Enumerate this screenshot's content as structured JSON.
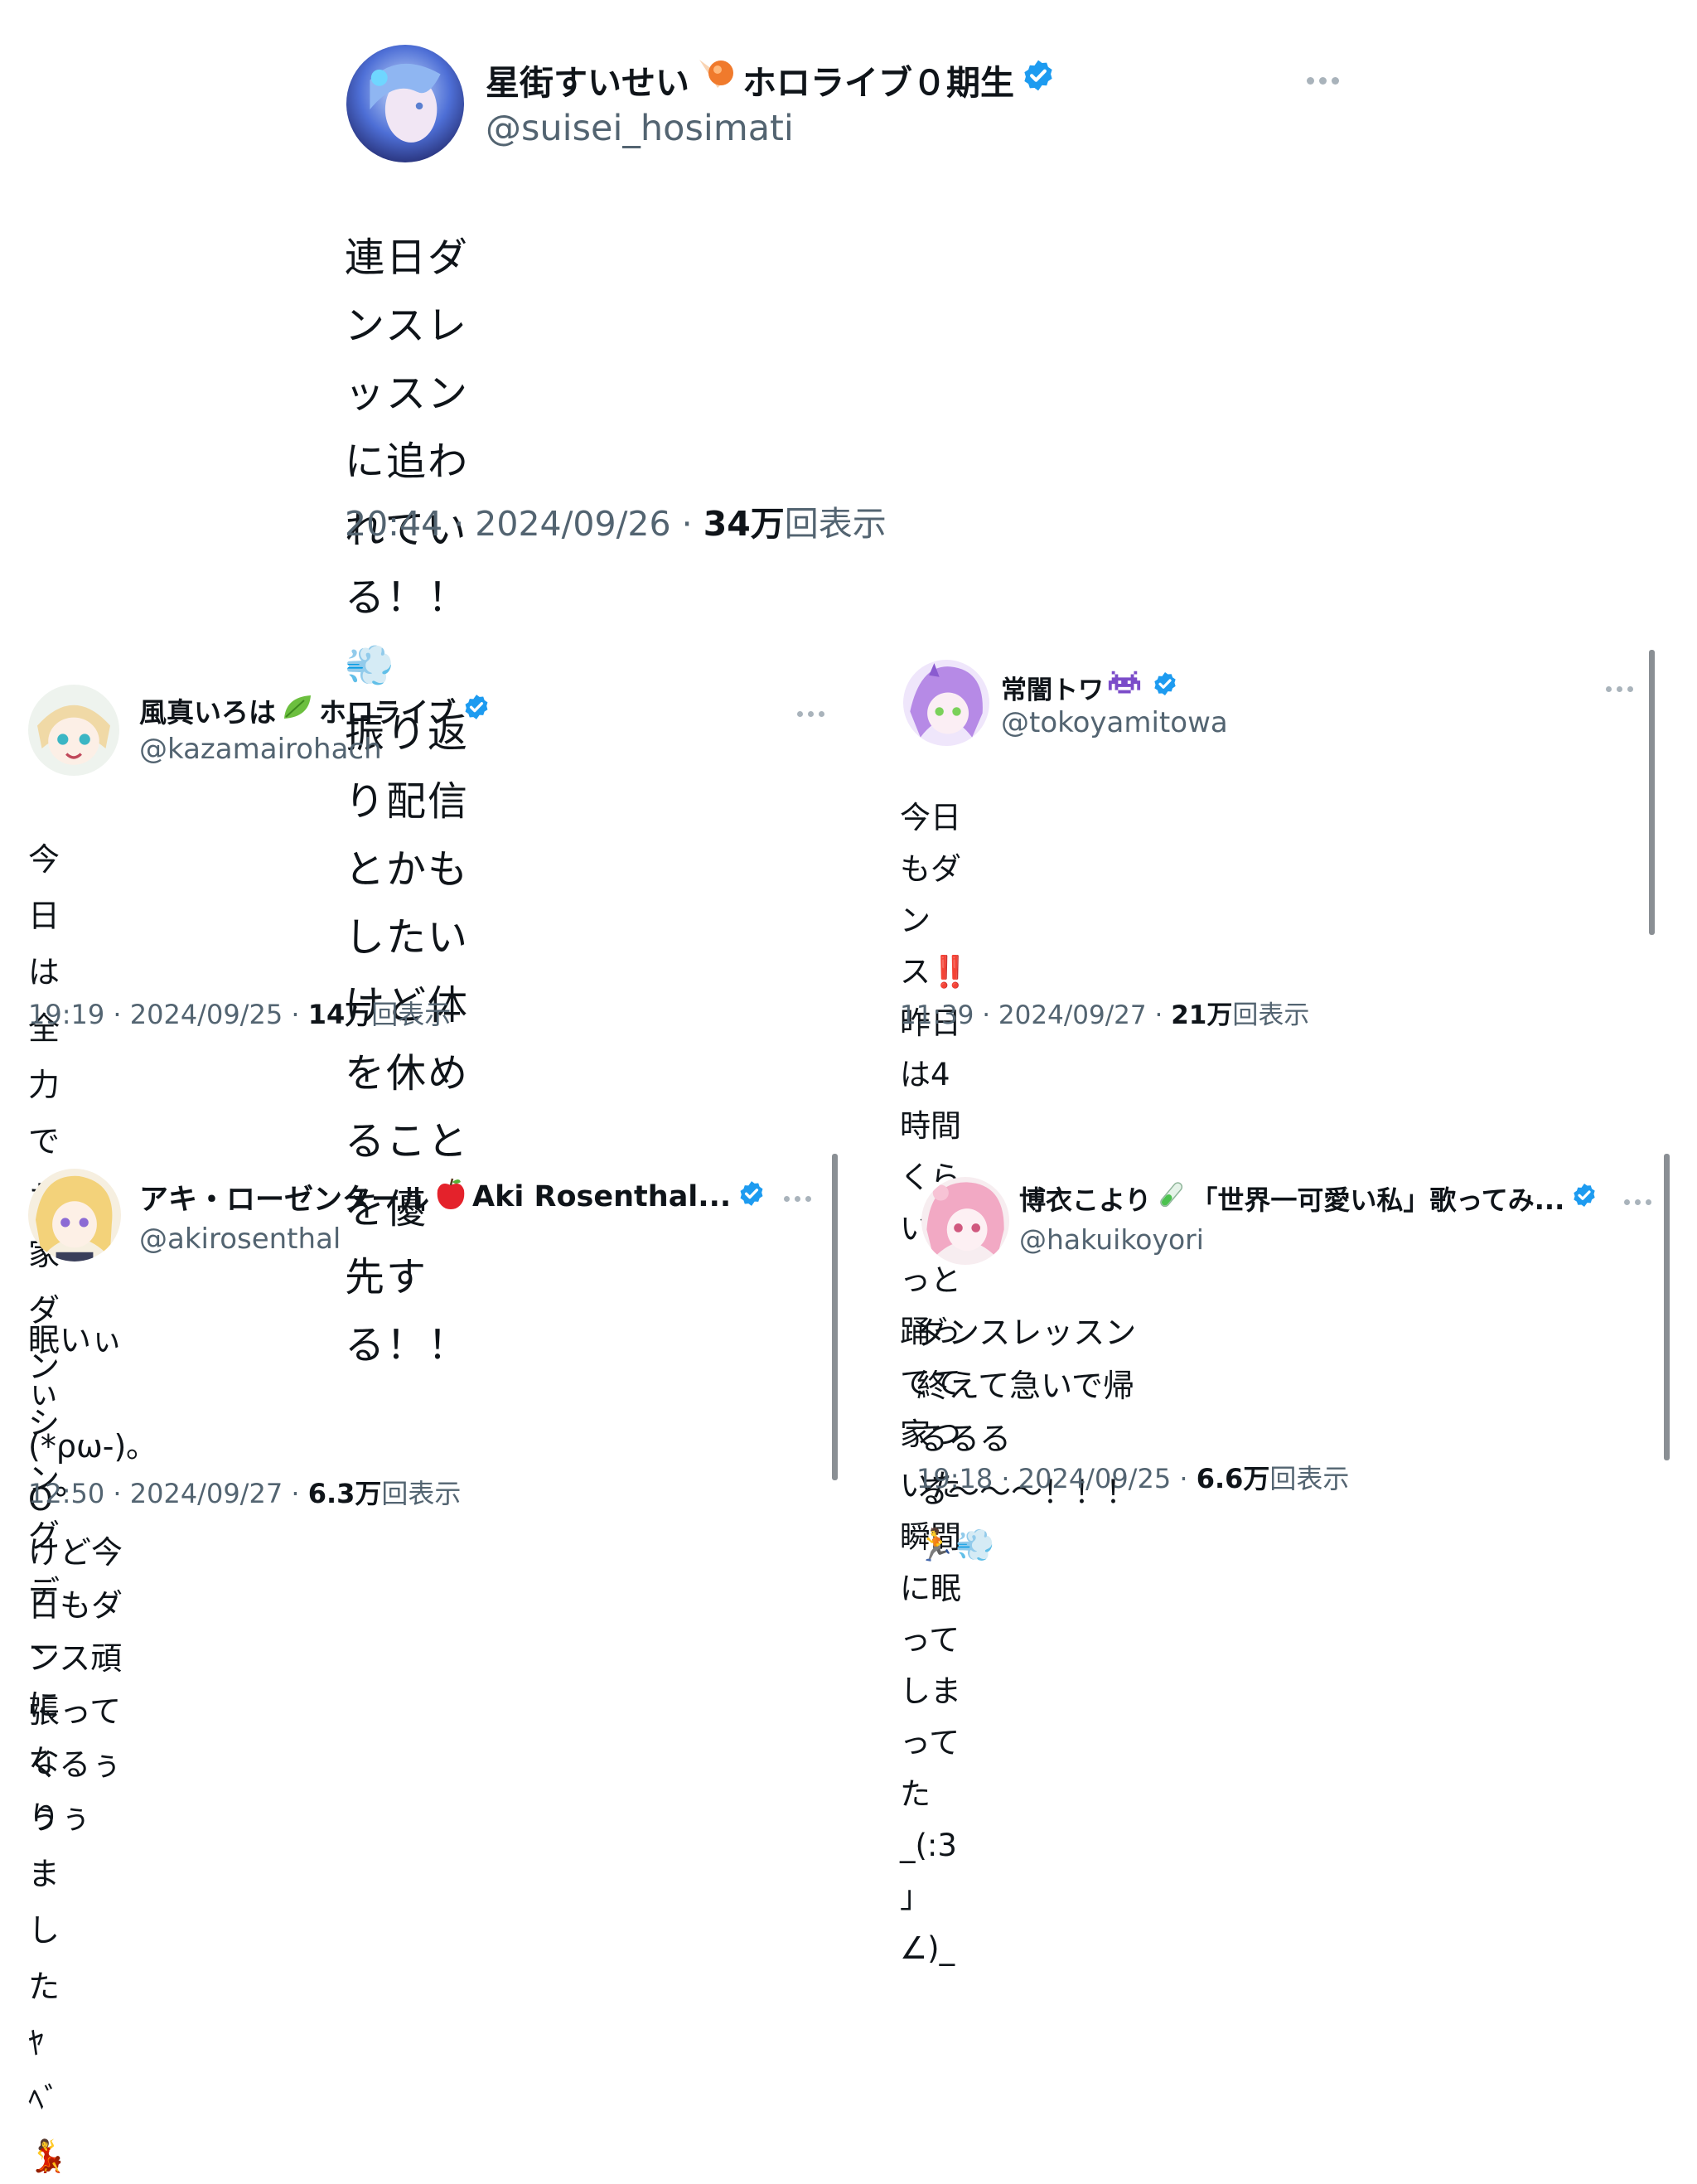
{
  "tweets": {
    "suisei": {
      "name": "星街すいせい",
      "name_suffix": "ホロライブ０期生",
      "name_emoji": "comet-emoji",
      "handle": "@suisei_hosimati",
      "body": "連日ダンスレッスンに追われている！！💨\n振り返り配信とかもしたいけど体を休めることを優\n先する！！",
      "time": "20:44",
      "date": "2024/09/26",
      "views": "34万",
      "views_label": "回表示"
    },
    "iroha": {
      "name": "風真いろは",
      "name_suffix": "ホロライブ",
      "name_emoji": "leaf-emoji",
      "handle": "@kazamairohach",
      "body": "今日は全力でお家ダンシングデーになりましたﾔﾍﾞ\n💃",
      "time": "19:19",
      "date": "2024/09/25",
      "views": "14万",
      "views_label": "回表示"
    },
    "towa": {
      "name": "常闇トワ",
      "name_emoji": "alien-monster-emoji",
      "handle": "@tokoyamitowa",
      "body": "今日もダンス‼️\n昨日は4時間くらいずっと踊ってて\n家ついた瞬間に眠ってしまってた_(:3 」∠)_",
      "time": "11:39",
      "date": "2024/09/27",
      "views": "21万",
      "views_label": "回表示"
    },
    "aki": {
      "name": "アキ・ローゼンタール",
      "name_suffix": "Aki Rosenthal...",
      "name_emoji": "apple-emoji",
      "handle": "@akirosenthal",
      "body": "眠いぃぃ(*ρω-)｡O°\nけど今日もダンス頑張ってくるぅぅぅ",
      "time": "12:50",
      "date": "2024/09/27",
      "views": "6.3万",
      "views_label": "回表示"
    },
    "koyori": {
      "name": "博衣こより",
      "name_suffix": "「世界一可愛い私」歌ってみ...",
      "name_emoji": "test-tube-emoji",
      "handle": "@hakuikoyori",
      "body": "ダンスレッスン終えて急いで帰るるる\nる〜〜〜！！！🏃💨",
      "time": "19:18",
      "date": "2024/09/25",
      "views": "6.6万",
      "views_label": "回表示"
    }
  },
  "colors": {
    "verified": "#1d9bf0",
    "text": "#0f1419",
    "secondary": "#536471"
  }
}
